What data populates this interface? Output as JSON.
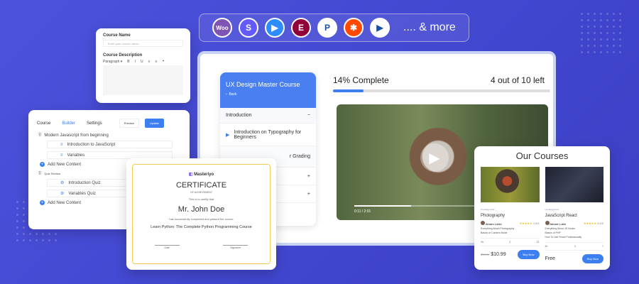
{
  "integrations": {
    "logos": [
      {
        "name": "woocommerce",
        "label": "Woo",
        "color": "#7f54b3"
      },
      {
        "name": "stripe",
        "label": "S",
        "color": "#635bff"
      },
      {
        "name": "zoom",
        "label": "▶",
        "color": "#2d8cff"
      },
      {
        "name": "elementor",
        "label": "E",
        "color": "#92003b"
      },
      {
        "name": "paypal",
        "label": "P",
        "color": "#ffffff"
      },
      {
        "name": "zapier",
        "label": "✱",
        "color": "#ff4a00"
      },
      {
        "name": "google-meet",
        "label": "▶",
        "color": "#ffffff"
      }
    ],
    "more_label": ".... & more"
  },
  "course_form": {
    "name_label": "Course Name",
    "name_placeholder": "Enter your course name...",
    "desc_label": "Course Description",
    "toolbar": [
      "Paragraph ▾",
      "B",
      "I",
      "U",
      "≡",
      "≡",
      "❝"
    ]
  },
  "builder": {
    "tabs": [
      "Course",
      "Builder",
      "Settings"
    ],
    "preview": "Preview",
    "update": "Update",
    "sections": [
      {
        "title": "Modern Javascript from beginning",
        "items": [
          "Introduction to JavaScript",
          "Variables"
        ]
      },
      {
        "title": "Quiz Section",
        "items": [
          "Introduction Quiz",
          "Variables Quiz"
        ]
      }
    ],
    "add_content": "Add New Content"
  },
  "learn": {
    "course_title": "UX Design Master Course",
    "back": "Back",
    "section": "Introduction",
    "lesson": "Introduction on Typography for Beginners",
    "lesson2": "r Grading",
    "progress_label": "14% Complete",
    "progress": 14,
    "lessons_left": "4 out of 10 left",
    "video_time": "0:11 / 2:01"
  },
  "certificate": {
    "brand": "Masteriyo",
    "title": "CERTIFICATE",
    "subtitle": "OF ACHIEVEMENT",
    "certify": "This is to certify that",
    "name": "Mr. John Doe",
    "completed": "has successfully completed and passed the course",
    "course": "Learn Python: The Complete Python Programming Course",
    "date": "Date",
    "signature": "Signature"
  },
  "courses": {
    "title": "Our Courses",
    "items": [
      {
        "category": "Uncategorized",
        "title": "Photography",
        "author": "Abram Lubin",
        "rating": "4.5/5",
        "features": [
          "Everything About Photography",
          "Basics of Camera Mode"
        ],
        "stats": [
          "3h",
          "3",
          "12"
        ],
        "old_price": "$19.99",
        "price": "$10.99",
        "cta": "Buy Now"
      },
      {
        "category": "Uncategorized",
        "title": "JavaScript React",
        "author": "Abram Lubin",
        "rating": "4.5/5",
        "features": [
          "Everything About JS Hooks",
          "Basics of PHP",
          "How To Use React Professionally"
        ],
        "stats": [
          "4h",
          "3",
          "7"
        ],
        "old_price": "",
        "price": "Free",
        "cta": "Buy Now"
      }
    ]
  }
}
